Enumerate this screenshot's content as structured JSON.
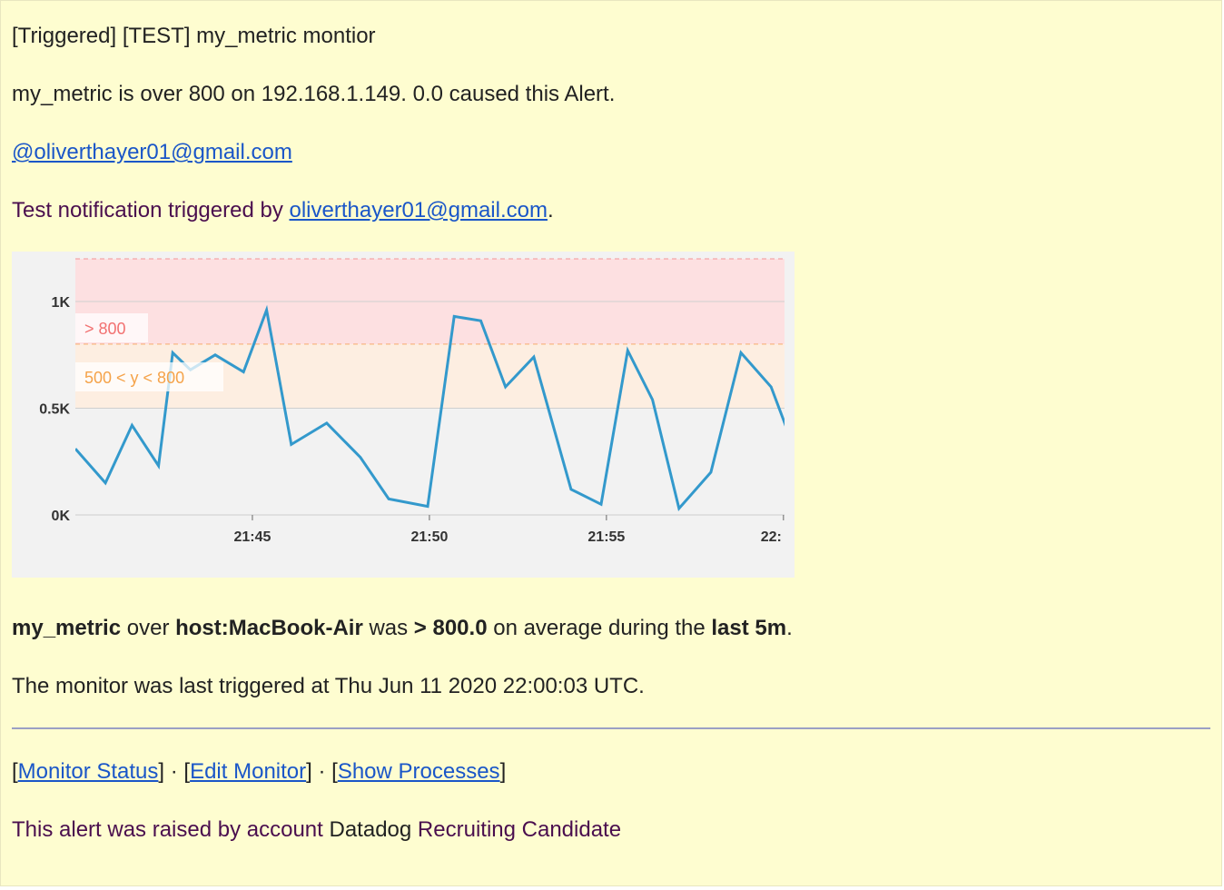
{
  "email": {
    "subject": "[Triggered] [TEST] my_metric montior",
    "summary": "my_metric is over 800 on 192.168.1.149. 0.0 caused this Alert.",
    "mention": "@oliverthayer01@gmail.com",
    "test_prefix": "Test notification triggered by ",
    "test_email": "oliverthayer01@gmail.com",
    "test_suffix": ".",
    "detail": {
      "metric": "my_metric",
      "over": " over ",
      "host": "host:MacBook-Air",
      "was": " was ",
      "threshold": "> 800.0",
      "avg": " on average during the ",
      "window": "last 5m",
      "end": "."
    },
    "last_triggered": "The monitor was last triggered at Thu Jun 11 2020 22:00:03 UTC.",
    "links": {
      "open1": "[",
      "monitor_status": "Monitor Status",
      "sep1": "] · [",
      "edit_monitor": "Edit Monitor",
      "sep2": "] · [",
      "show_processes": "Show Processes",
      "close": "]"
    },
    "footer": {
      "prefix": "This alert was raised by account ",
      "account": "Datadog",
      "suffix": " Recruiting Candidate"
    }
  },
  "colors": {
    "background": "#fefdd0",
    "link": "#1a56c8",
    "purple_text": "#4a0e4e",
    "series": "#3399cc",
    "alert_zone": "#fde0e1",
    "warn_zone": "#fdeee1",
    "alert_label": "#f27171",
    "warn_label": "#f5a34a"
  },
  "chart_data": {
    "type": "line",
    "x_tick_labels": [
      "21:45",
      "21:50",
      "21:55",
      "22:"
    ],
    "y_tick_labels": [
      "1K",
      "0.5K",
      "0K"
    ],
    "y_ticks": [
      1000,
      500,
      0
    ],
    "x_ticks": [
      5,
      10,
      15,
      20
    ],
    "ylim": [
      0,
      1200
    ],
    "xlim": [
      0,
      20
    ],
    "thresholds": [
      {
        "label": "> 800",
        "from": 800,
        "to": 1200,
        "kind": "alert"
      },
      {
        "label": "500 < y < 800",
        "from": 500,
        "to": 800,
        "kind": "warning"
      }
    ],
    "series": [
      {
        "x": [
          0,
          0.85,
          1.6,
          2.35,
          2.75,
          3.25,
          3.95,
          4.75,
          5.4,
          6.1,
          7.1,
          8.05,
          8.85,
          9.95,
          10.7,
          11.45,
          12.15,
          12.95,
          14.0,
          14.85,
          15.6,
          16.3,
          17.05,
          17.95,
          18.8,
          19.65,
          20.4
        ],
        "y": [
          310,
          150,
          420,
          230,
          760,
          680,
          750,
          670,
          960,
          330,
          430,
          270,
          75,
          40,
          930,
          910,
          600,
          740,
          120,
          50,
          770,
          540,
          30,
          200,
          760,
          600,
          270
        ]
      }
    ]
  }
}
